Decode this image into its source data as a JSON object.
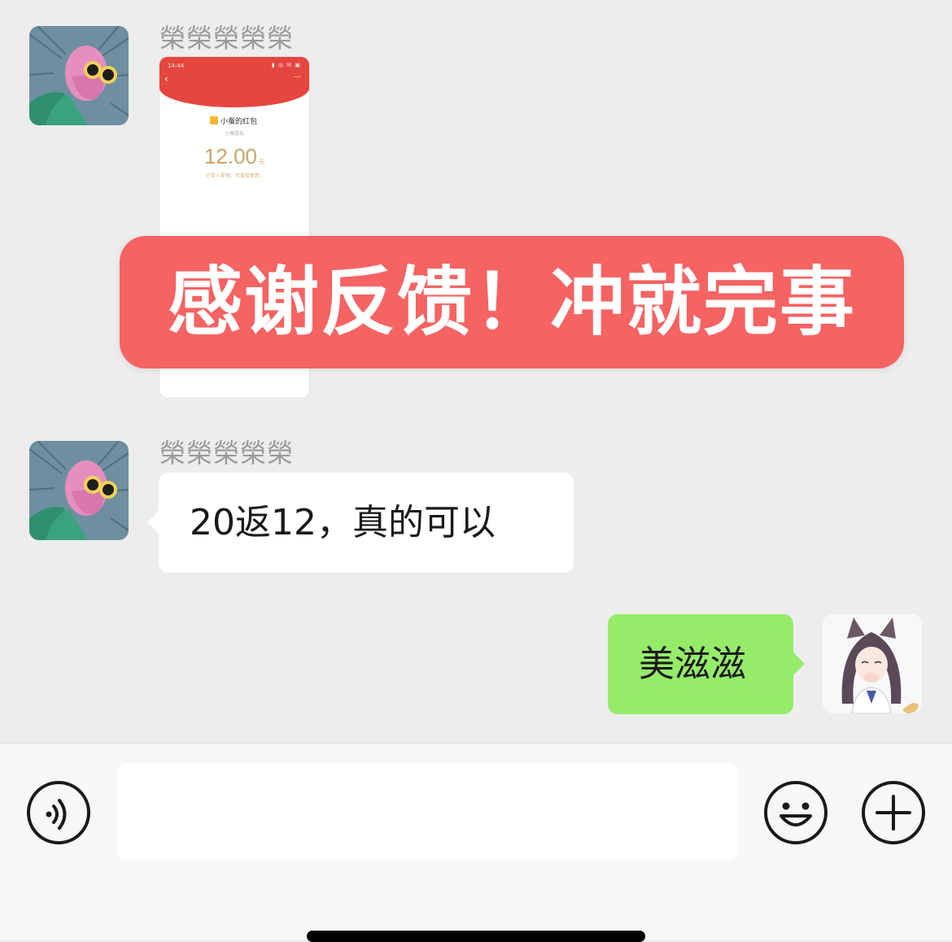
{
  "messages": [
    {
      "sender_name": "榮榮榮榮榮",
      "avatar_icon": "bald-pink-man-sunglasses-avatar",
      "type": "image",
      "screenshot": {
        "status_time": "14:44",
        "status_icons": "▮ ◎ ✉ ▣",
        "back_icon": "‹",
        "more_icon": "···",
        "app_name": "小蚕的红包",
        "subtitle": "小蚕提现",
        "amount": "12.00",
        "amount_unit": "元",
        "note": "已存入零钱，可直接使用 ›"
      }
    },
    {
      "sender_name": "榮榮榮榮榮",
      "avatar_icon": "bald-pink-man-sunglasses-avatar",
      "type": "text",
      "text": "20返12，真的可以"
    },
    {
      "sender_name": "",
      "avatar_icon": "anime-cat-girl-avatar",
      "type": "text",
      "outgoing": true,
      "text": "美滋滋"
    }
  ],
  "banner": {
    "text": "感谢反馈！冲就完事",
    "color": "#f56363"
  },
  "input_bar": {
    "voice_icon": "voice-icon",
    "emoji_icon": "emoji-icon",
    "plus_icon": "plus-icon",
    "input_value": ""
  },
  "colors": {
    "chat_bg": "#ededed",
    "outgoing_bubble": "#95ec69",
    "incoming_bubble": "#ffffff",
    "red_packet_header": "#e5463f",
    "amount_gold": "#c9a46a"
  }
}
